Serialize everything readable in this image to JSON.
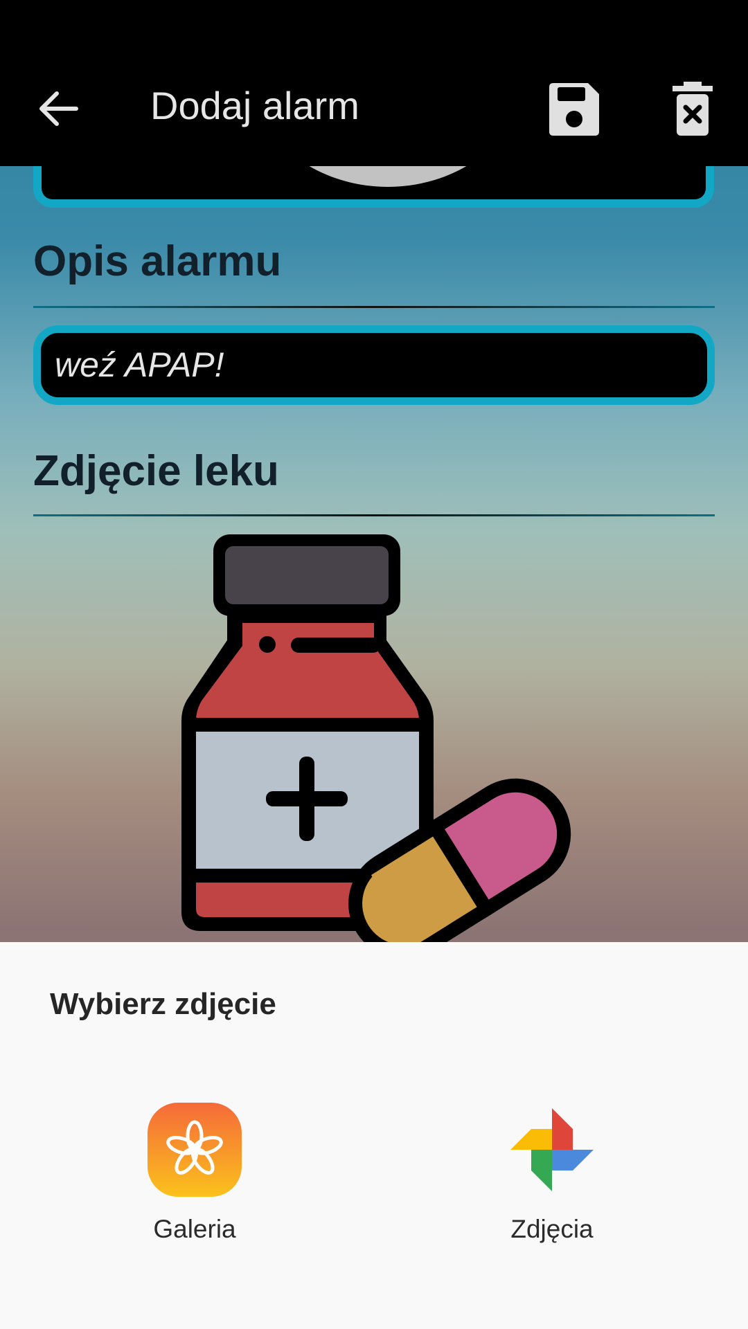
{
  "toolbar": {
    "title": "Dodaj alarm",
    "back_icon": "arrow-back-icon",
    "save_icon": "floppy-disk-icon",
    "delete_icon": "trash-icon"
  },
  "form": {
    "description_heading": "Opis alarmu",
    "description_value": "weź APAP!",
    "photo_heading": "Zdjęcie leku",
    "photo_image": "medicine-bottle-and-pill-image"
  },
  "chooser": {
    "title": "Wybierz zdjęcie",
    "apps": [
      {
        "label": "Galeria",
        "icon": "gallery-app-icon"
      },
      {
        "label": "Zdjęcia",
        "icon": "google-photos-icon"
      }
    ]
  },
  "colors": {
    "accent": "#12a8c5",
    "toolbar_bg": "#000000",
    "sheet_bg": "#f9f9f9"
  }
}
